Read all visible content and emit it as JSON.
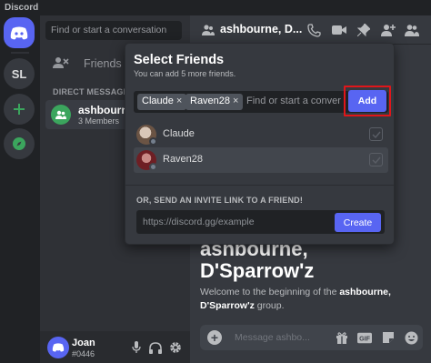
{
  "window": {
    "title": "Discord"
  },
  "servers": {
    "home_icon": "discord-logo-icon",
    "user_server": "SL"
  },
  "sidebar": {
    "search_placeholder": "Find or start a conversation",
    "friends_label": "Friends",
    "dm_header": "DIRECT MESSAGES",
    "dm": {
      "name": "ashbourne",
      "members": "3 Members"
    }
  },
  "user": {
    "name": "Joan",
    "tag": "#0446"
  },
  "header": {
    "title": "ashbourne, D..."
  },
  "welcome": {
    "title_line1": "ashbourne,",
    "title_line2": "D'Sparrow'z",
    "text_before": "Welcome to the beginning of the ",
    "group_name": "ashbourne, D'Sparrow'z",
    "text_after": " group."
  },
  "composer": {
    "placeholder": "Message ashbo..."
  },
  "popup": {
    "title": "Select Friends",
    "subtitle": "You can add 5 more friends.",
    "chips": [
      "Claude",
      "Raven28"
    ],
    "input_placeholder": "Find or start a conver",
    "add_label": "Add",
    "friends": [
      {
        "name": "Claude",
        "checked": true
      },
      {
        "name": "Raven28",
        "checked": true
      }
    ],
    "invite_header": "OR, SEND AN INVITE LINK TO A FRIEND!",
    "invite_url": "https://discord.gg/example",
    "create_label": "Create"
  },
  "colors": {
    "blurple": "#5865f2",
    "green": "#3ba55d",
    "highlight": "#e0161a"
  }
}
